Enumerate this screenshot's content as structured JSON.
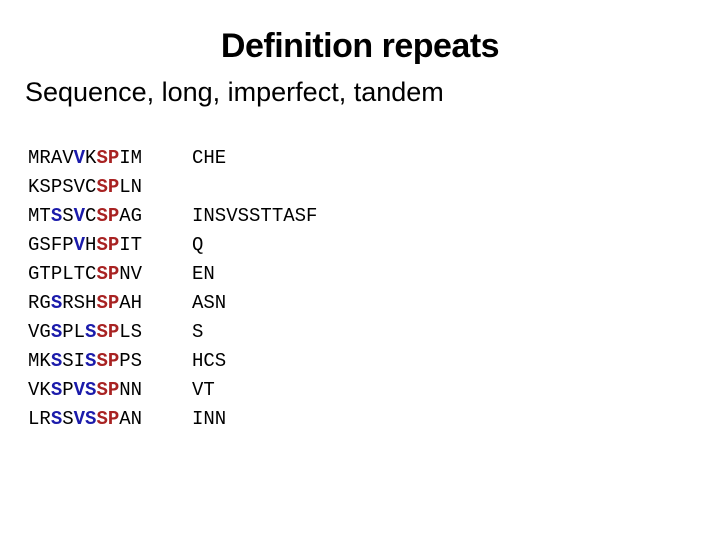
{
  "slide": {
    "title": "Definition repeats",
    "subtitle": "Sequence, long, imperfect, tandem",
    "background_color": "#ffffff",
    "text_color": "#000000"
  },
  "colors": {
    "plain": "#000000",
    "blue": "#1b1bab",
    "red": "#a82222"
  },
  "sequence_block": {
    "description": "Aligned protein sequence repeats; conserved SP motif highlighted in red, other conserved residues in blue",
    "lines": [
      {
        "index": 1,
        "left": "MRAVVKSPIM",
        "right": "CHE",
        "residues": [
          {
            "char": "M",
            "color": "plain"
          },
          {
            "char": "R",
            "color": "plain"
          },
          {
            "char": "A",
            "color": "plain"
          },
          {
            "char": "V",
            "color": "plain"
          },
          {
            "char": "V",
            "color": "blue"
          },
          {
            "char": "K",
            "color": "plain"
          },
          {
            "char": "S",
            "color": "red"
          },
          {
            "char": "P",
            "color": "red"
          },
          {
            "char": "I",
            "color": "plain"
          },
          {
            "char": "M",
            "color": "plain"
          }
        ]
      },
      {
        "index": 2,
        "left": "KSPSVCSPLN",
        "right": "",
        "residues": [
          {
            "char": "K",
            "color": "plain"
          },
          {
            "char": "S",
            "color": "plain"
          },
          {
            "char": "P",
            "color": "plain"
          },
          {
            "char": "S",
            "color": "plain"
          },
          {
            "char": "V",
            "color": "plain"
          },
          {
            "char": "C",
            "color": "plain"
          },
          {
            "char": "S",
            "color": "red"
          },
          {
            "char": "P",
            "color": "red"
          },
          {
            "char": "L",
            "color": "plain"
          },
          {
            "char": "N",
            "color": "plain"
          }
        ]
      },
      {
        "index": 3,
        "left": "MTSSVCSPAG",
        "right": "INSVSSTTASF",
        "residues": [
          {
            "char": "M",
            "color": "plain"
          },
          {
            "char": "T",
            "color": "plain"
          },
          {
            "char": "S",
            "color": "blue"
          },
          {
            "char": "S",
            "color": "plain"
          },
          {
            "char": "V",
            "color": "blue"
          },
          {
            "char": "C",
            "color": "plain"
          },
          {
            "char": "S",
            "color": "red"
          },
          {
            "char": "P",
            "color": "red"
          },
          {
            "char": "A",
            "color": "plain"
          },
          {
            "char": "G",
            "color": "plain"
          }
        ]
      },
      {
        "index": 4,
        "left": "GSFPVHSPIT",
        "right": "Q",
        "residues": [
          {
            "char": "G",
            "color": "plain"
          },
          {
            "char": "S",
            "color": "plain"
          },
          {
            "char": "F",
            "color": "plain"
          },
          {
            "char": "P",
            "color": "plain"
          },
          {
            "char": "V",
            "color": "blue"
          },
          {
            "char": "H",
            "color": "plain"
          },
          {
            "char": "S",
            "color": "red"
          },
          {
            "char": "P",
            "color": "red"
          },
          {
            "char": "I",
            "color": "plain"
          },
          {
            "char": "T",
            "color": "plain"
          }
        ]
      },
      {
        "index": 5,
        "left": "GTPLTCSPNV",
        "right": "EN",
        "residues": [
          {
            "char": "G",
            "color": "plain"
          },
          {
            "char": "T",
            "color": "plain"
          },
          {
            "char": "P",
            "color": "plain"
          },
          {
            "char": "L",
            "color": "plain"
          },
          {
            "char": "T",
            "color": "plain"
          },
          {
            "char": "C",
            "color": "plain"
          },
          {
            "char": "S",
            "color": "red"
          },
          {
            "char": "P",
            "color": "red"
          },
          {
            "char": "N",
            "color": "plain"
          },
          {
            "char": "V",
            "color": "plain"
          }
        ]
      },
      {
        "index": 6,
        "left": "RGSRSHSPAH",
        "right": "ASN",
        "residues": [
          {
            "char": "R",
            "color": "plain"
          },
          {
            "char": "G",
            "color": "plain"
          },
          {
            "char": "S",
            "color": "blue"
          },
          {
            "char": "R",
            "color": "plain"
          },
          {
            "char": "S",
            "color": "plain"
          },
          {
            "char": "H",
            "color": "plain"
          },
          {
            "char": "S",
            "color": "red"
          },
          {
            "char": "P",
            "color": "red"
          },
          {
            "char": "A",
            "color": "plain"
          },
          {
            "char": "H",
            "color": "plain"
          }
        ]
      },
      {
        "index": 7,
        "left": "VGSPLSSPLS",
        "right": "S",
        "residues": [
          {
            "char": "V",
            "color": "plain"
          },
          {
            "char": "G",
            "color": "plain"
          },
          {
            "char": "S",
            "color": "blue"
          },
          {
            "char": "P",
            "color": "plain"
          },
          {
            "char": "L",
            "color": "plain"
          },
          {
            "char": "S",
            "color": "blue"
          },
          {
            "char": "S",
            "color": "red"
          },
          {
            "char": "P",
            "color": "red"
          },
          {
            "char": "L",
            "color": "plain"
          },
          {
            "char": "S",
            "color": "plain"
          }
        ]
      },
      {
        "index": 8,
        "left": "MKSSISSPPS",
        "right": "HCS",
        "residues": [
          {
            "char": "M",
            "color": "plain"
          },
          {
            "char": "K",
            "color": "plain"
          },
          {
            "char": "S",
            "color": "blue"
          },
          {
            "char": "S",
            "color": "plain"
          },
          {
            "char": "I",
            "color": "plain"
          },
          {
            "char": "S",
            "color": "blue"
          },
          {
            "char": "S",
            "color": "red"
          },
          {
            "char": "P",
            "color": "red"
          },
          {
            "char": "P",
            "color": "plain"
          },
          {
            "char": "S",
            "color": "plain"
          }
        ]
      },
      {
        "index": 9,
        "left": "VKSPVSSPNN",
        "right": "VT",
        "residues": [
          {
            "char": "V",
            "color": "plain"
          },
          {
            "char": "K",
            "color": "plain"
          },
          {
            "char": "S",
            "color": "blue"
          },
          {
            "char": "P",
            "color": "plain"
          },
          {
            "char": "V",
            "color": "blue"
          },
          {
            "char": "S",
            "color": "blue"
          },
          {
            "char": "S",
            "color": "red"
          },
          {
            "char": "P",
            "color": "red"
          },
          {
            "char": "N",
            "color": "plain"
          },
          {
            "char": "N",
            "color": "plain"
          }
        ]
      },
      {
        "index": 10,
        "left": "LRSSVSSPAN",
        "right": "INN",
        "residues": [
          {
            "char": "L",
            "color": "plain"
          },
          {
            "char": "R",
            "color": "plain"
          },
          {
            "char": "S",
            "color": "blue"
          },
          {
            "char": "S",
            "color": "plain"
          },
          {
            "char": "V",
            "color": "blue"
          },
          {
            "char": "S",
            "color": "blue"
          },
          {
            "char": "S",
            "color": "red"
          },
          {
            "char": "P",
            "color": "red"
          },
          {
            "char": "A",
            "color": "plain"
          },
          {
            "char": "N",
            "color": "plain"
          }
        ]
      }
    ]
  }
}
